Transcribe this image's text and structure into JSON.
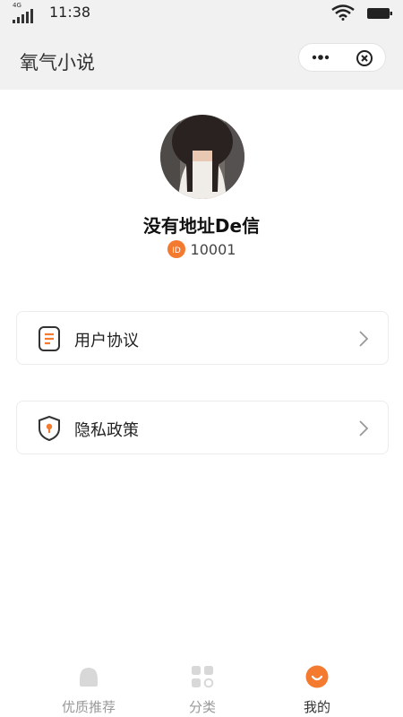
{
  "status_bar": {
    "network": "4G",
    "time": "11:38"
  },
  "nav": {
    "title": "氧气小说"
  },
  "profile": {
    "nickname": "没有地址De信",
    "id_badge": "ID",
    "user_id": "10001"
  },
  "menu": [
    {
      "label": "用户协议",
      "icon": "document-icon"
    },
    {
      "label": "隐私政策",
      "icon": "shield-icon"
    }
  ],
  "tabbar": {
    "tabs": [
      {
        "label": "优质推荐",
        "icon": "recommend-icon",
        "active": false
      },
      {
        "label": "分类",
        "icon": "category-icon",
        "active": false
      },
      {
        "label": "我的",
        "icon": "profile-icon",
        "active": true
      }
    ]
  },
  "colors": {
    "accent": "#f47a30",
    "header_bg": "#f1f1f1",
    "inactive_icon": "#d8d8d8"
  }
}
